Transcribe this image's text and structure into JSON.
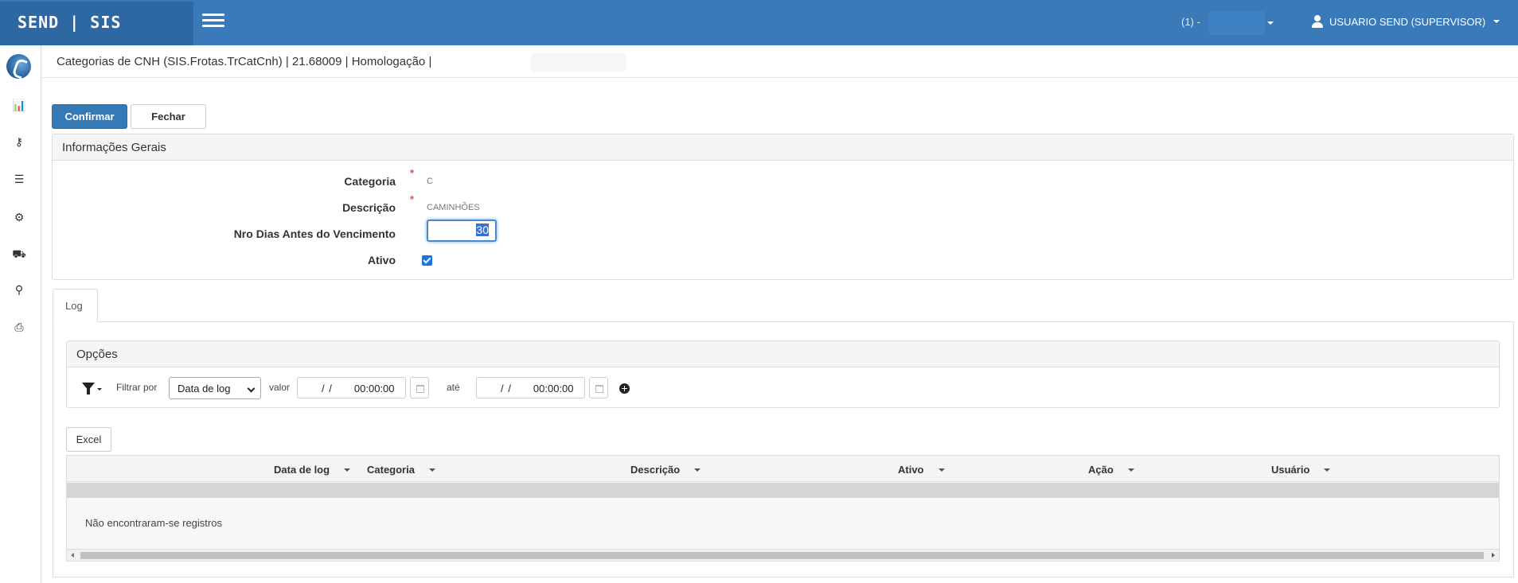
{
  "topbar": {
    "brand": "SEND | SIS",
    "company": "(1) -",
    "user": "USUARIO SEND (SUPERVISOR)"
  },
  "sidebar": {
    "items": [
      {
        "icon": "bar-chart-icon",
        "glyph": "📊"
      },
      {
        "icon": "key-icon",
        "glyph": "⚷"
      },
      {
        "icon": "server-icon",
        "glyph": "☰"
      },
      {
        "icon": "cogs-icon",
        "glyph": "⚙"
      },
      {
        "icon": "truck-icon",
        "glyph": "⛟"
      },
      {
        "icon": "search-icon",
        "glyph": "⚲"
      },
      {
        "icon": "print-icon",
        "glyph": "⎙"
      }
    ]
  },
  "page": {
    "title": "Categorias de CNH (SIS.Frotas.TrCatCnh) | 21.68009 | Homologação |"
  },
  "toolbar": {
    "confirm_label": "Confirmar",
    "close_label": "Fechar"
  },
  "info_panel": {
    "heading": "Informações Gerais",
    "categoria_label": "Categoria",
    "categoria_value": "C",
    "descricao_label": "Descrição",
    "descricao_value": "CAMINHÕES",
    "dias_label": "Nro Dias Antes do Vencimento",
    "dias_value": "30",
    "ativo_label": "Ativo",
    "ativo_checked": true,
    "required_mark": "*"
  },
  "tabs": {
    "log_label": "Log"
  },
  "options": {
    "heading": "Opções",
    "filter_by_label": "Filtrar por",
    "filter_select_value": "Data de log",
    "valor_label": "valor",
    "from_date": "/ /",
    "from_time": "00:00:00",
    "ate_label": "até",
    "to_date": "/ /",
    "to_time": "00:00:00"
  },
  "grid": {
    "excel_label": "Excel",
    "columns": [
      "Data de log",
      "Categoria",
      "Descrição",
      "Ativo",
      "Ação",
      "Usuário"
    ],
    "empty_text": "Não encontraram-se registros"
  }
}
